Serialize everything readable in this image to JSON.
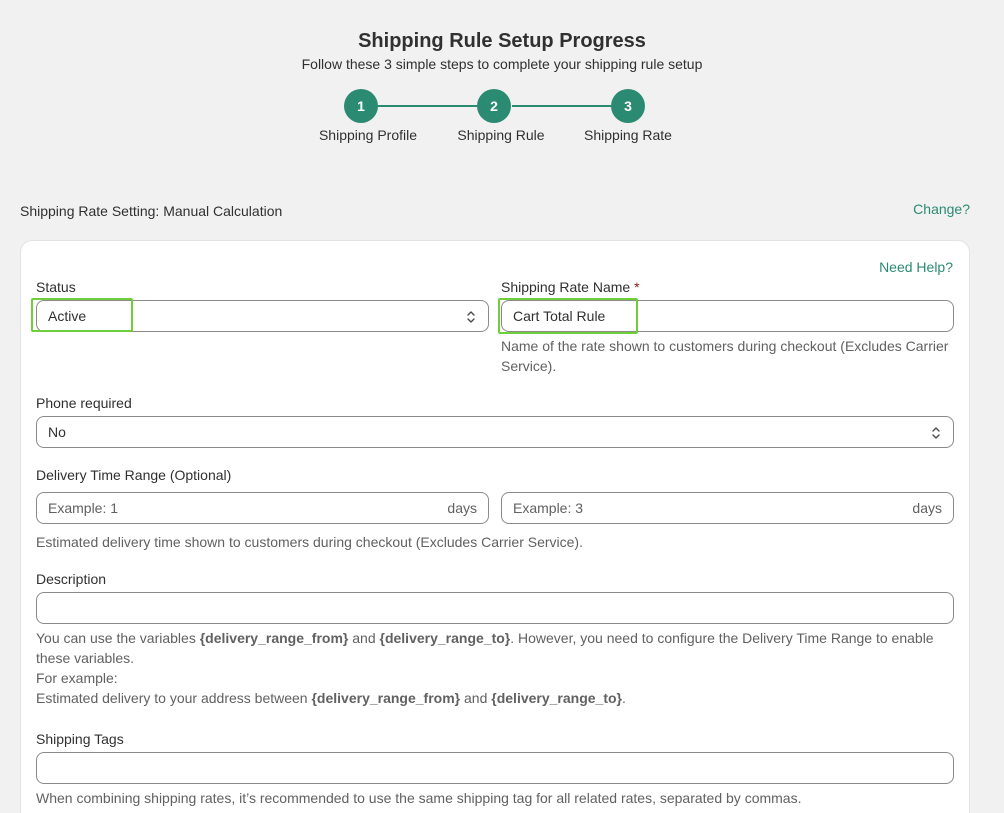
{
  "header": {
    "title": "Shipping Rule Setup Progress",
    "subtitle": "Follow these 3 simple steps to complete your shipping rule setup"
  },
  "steps": [
    {
      "number": "1",
      "label": "Shipping Profile"
    },
    {
      "number": "2",
      "label": "Shipping Rule"
    },
    {
      "number": "3",
      "label": "Shipping Rate"
    }
  ],
  "setting": {
    "text": "Shipping Rate Setting: Manual Calculation",
    "change_label": "Change?"
  },
  "form": {
    "need_help_label": "Need Help?",
    "status": {
      "label": "Status",
      "value": "Active"
    },
    "rate_name": {
      "label": "Shipping Rate Name",
      "required_mark": "*",
      "value": "Cart Total Rule",
      "help": "Name of the rate shown to customers during checkout (Excludes Carrier Service)."
    },
    "phone": {
      "label": "Phone required",
      "value": "No"
    },
    "delivery": {
      "label": "Delivery Time Range (Optional)",
      "from_placeholder": "Example: 1",
      "to_placeholder": "Example: 3",
      "suffix": "days",
      "help": "Estimated delivery time shown to customers during checkout (Excludes Carrier Service)."
    },
    "description": {
      "label": "Description",
      "value": "",
      "help_1": "You can use the variables ",
      "var_from": "{delivery_range_from}",
      "and": " and ",
      "var_to": "{delivery_range_to}",
      "help_2": ". However, you need to configure the Delivery Time Range to enable these variables.",
      "example_label": "For example:",
      "example_text": "Estimated delivery to your address between ",
      "period": "."
    },
    "tags": {
      "label": "Shipping Tags",
      "value": "",
      "help": "When combining shipping rates, it’s recommended to use the same shipping tag for all related rates, separated by commas."
    }
  },
  "colors": {
    "accent": "#2b8a72",
    "highlight": "#6fcf3a"
  }
}
